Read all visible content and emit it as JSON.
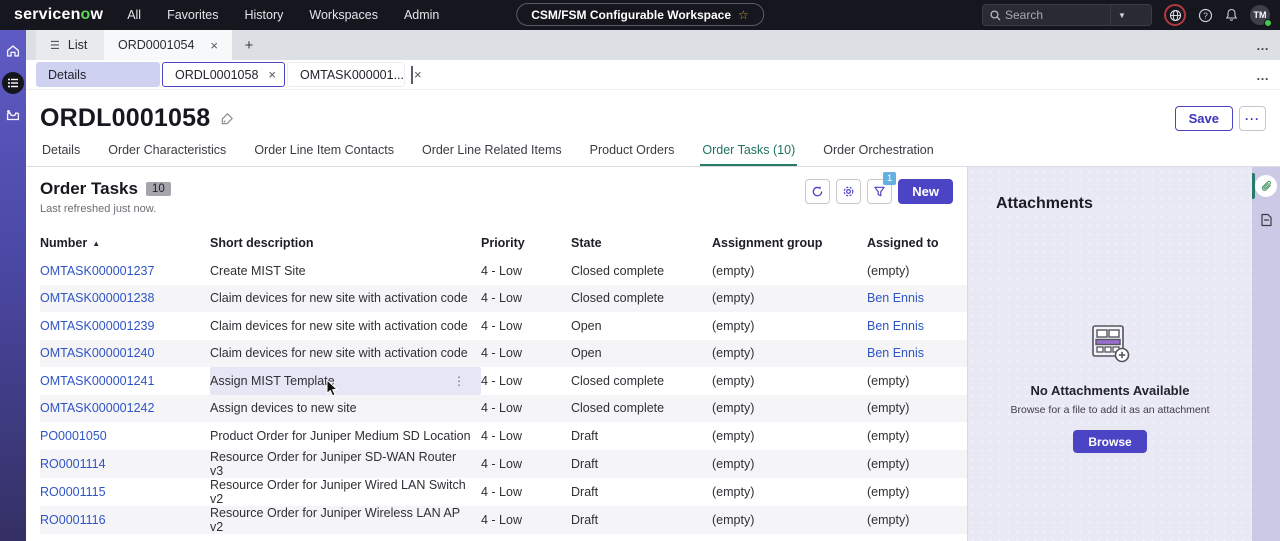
{
  "topnav": {
    "brand": {
      "part1": "servicen",
      "green": "o",
      "part2": "w"
    },
    "menu": [
      "All",
      "Favorites",
      "History",
      "Workspaces",
      "Admin"
    ],
    "workspace_pill": "CSM/FSM Configurable Workspace",
    "search_placeholder": "Search",
    "avatar_initials": "TM"
  },
  "tabs_row1": {
    "list_label": "List",
    "tab": "ORD0001054",
    "add_label": "+",
    "close_label": "×",
    "overflow_label": "…"
  },
  "tabs_row2": {
    "details": "Details",
    "active_tab": "ORDL0001058",
    "other_tab": "OMTASK000001...",
    "close_label": "×",
    "overflow_label": "…"
  },
  "record": {
    "title": "ORDL0001058",
    "save_label": "Save",
    "more_label": "···"
  },
  "record_tabs": [
    "Details",
    "Order Characteristics",
    "Order Line Item Contacts",
    "Order Line Related Items",
    "Product Orders",
    "Order Tasks (10)",
    "Order Orchestration"
  ],
  "record_tabs_active_index": 5,
  "list": {
    "title": "Order Tasks",
    "count": "10",
    "refreshed": "Last refreshed just now.",
    "new_label": "New",
    "filter_badge": "1",
    "columns": [
      "Number",
      "Short description",
      "Priority",
      "State",
      "Assignment group",
      "Assigned to"
    ],
    "sorted_column_index": 0,
    "rows": [
      {
        "number": "OMTASK000001237",
        "short_description": "Create MIST Site",
        "priority": "4 - Low",
        "state": "Closed complete",
        "assignment_group": "(empty)",
        "assigned_to": "(empty)",
        "hovered": false
      },
      {
        "number": "OMTASK000001238",
        "short_description": "Claim devices for new site with activation code",
        "priority": "4 - Low",
        "state": "Closed complete",
        "assignment_group": "(empty)",
        "assigned_to": "Ben Ennis",
        "hovered": false
      },
      {
        "number": "OMTASK000001239",
        "short_description": "Claim devices for new site with activation code",
        "priority": "4 - Low",
        "state": "Open",
        "assignment_group": "(empty)",
        "assigned_to": "Ben Ennis",
        "hovered": false
      },
      {
        "number": "OMTASK000001240",
        "short_description": "Claim devices for new site with activation code",
        "priority": "4 - Low",
        "state": "Open",
        "assignment_group": "(empty)",
        "assigned_to": "Ben Ennis",
        "hovered": false
      },
      {
        "number": "OMTASK000001241",
        "short_description": "Assign MIST Template",
        "priority": "4 - Low",
        "state": "Closed complete",
        "assignment_group": "(empty)",
        "assigned_to": "(empty)",
        "hovered": true
      },
      {
        "number": "OMTASK000001242",
        "short_description": "Assign devices to new site",
        "priority": "4 - Low",
        "state": "Closed complete",
        "assignment_group": "(empty)",
        "assigned_to": "(empty)",
        "hovered": false
      },
      {
        "number": "PO0001050",
        "short_description": "Product Order for Juniper Medium SD Location",
        "priority": "4 - Low",
        "state": "Draft",
        "assignment_group": "(empty)",
        "assigned_to": "(empty)",
        "hovered": false
      },
      {
        "number": "RO0001114",
        "short_description": "Resource Order for Juniper SD-WAN Router v3",
        "priority": "4 - Low",
        "state": "Draft",
        "assignment_group": "(empty)",
        "assigned_to": "(empty)",
        "hovered": false
      },
      {
        "number": "RO0001115",
        "short_description": "Resource Order for Juniper Wired LAN Switch v2",
        "priority": "4 - Low",
        "state": "Draft",
        "assignment_group": "(empty)",
        "assigned_to": "(empty)",
        "hovered": false
      },
      {
        "number": "RO0001116",
        "short_description": "Resource Order for Juniper Wireless LAN AP v2",
        "priority": "4 - Low",
        "state": "Draft",
        "assignment_group": "(empty)",
        "assigned_to": "(empty)",
        "hovered": false
      }
    ]
  },
  "attachments": {
    "title": "Attachments",
    "empty_title": "No Attachments Available",
    "empty_subtitle": "Browse for a file to add it as an attachment",
    "browse_label": "Browse"
  },
  "colors": {
    "accent_indigo": "#4b45c6",
    "link_blue": "#2f55c5",
    "active_tab_teal": "#2a7a6a",
    "brand_green": "#5ed855",
    "filter_badge_blue": "#62b1e0",
    "topbar_dark": "#16161e",
    "sidebar_purple_top": "#5f5bc5",
    "sidebar_purple_bottom": "#343064",
    "attach_panel_bg": "#e9e8f5",
    "row_stripe": "#f5f5f8"
  }
}
